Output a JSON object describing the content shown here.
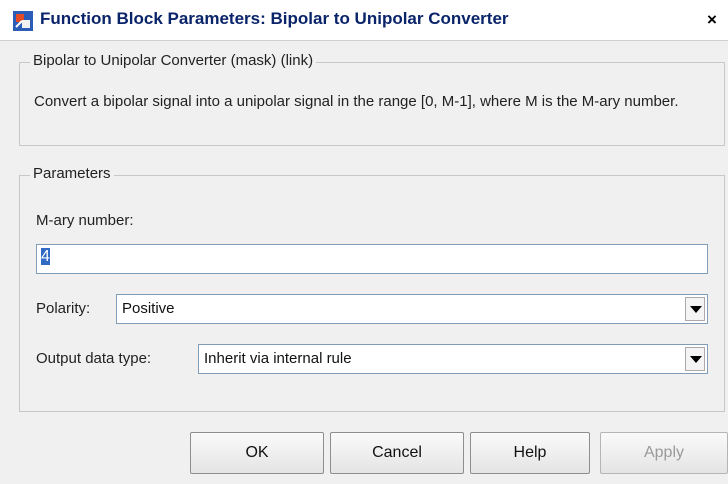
{
  "window": {
    "title": "Function Block Parameters: Bipolar to Unipolar Converter",
    "close_label": "×"
  },
  "mask_group": {
    "label": "Bipolar to Unipolar Converter (mask) (link)",
    "description": "Convert a bipolar signal into a unipolar signal in the range [0, M-1], where M is the M-ary number."
  },
  "params_group": {
    "label": "Parameters",
    "mary": {
      "label": "M-ary number:",
      "value": "4"
    },
    "polarity": {
      "label": "Polarity:",
      "value": "Positive"
    },
    "output_type": {
      "label": "Output data type:",
      "value": "Inherit via internal rule"
    }
  },
  "buttons": {
    "ok": "OK",
    "cancel": "Cancel",
    "help": "Help",
    "apply": "Apply"
  },
  "icons": {
    "app": "simulink-block-icon",
    "close": "close-icon",
    "dropdown": "chevron-down-icon"
  },
  "colors": {
    "title_text": "#0a246a",
    "selection": "#316ac5"
  }
}
